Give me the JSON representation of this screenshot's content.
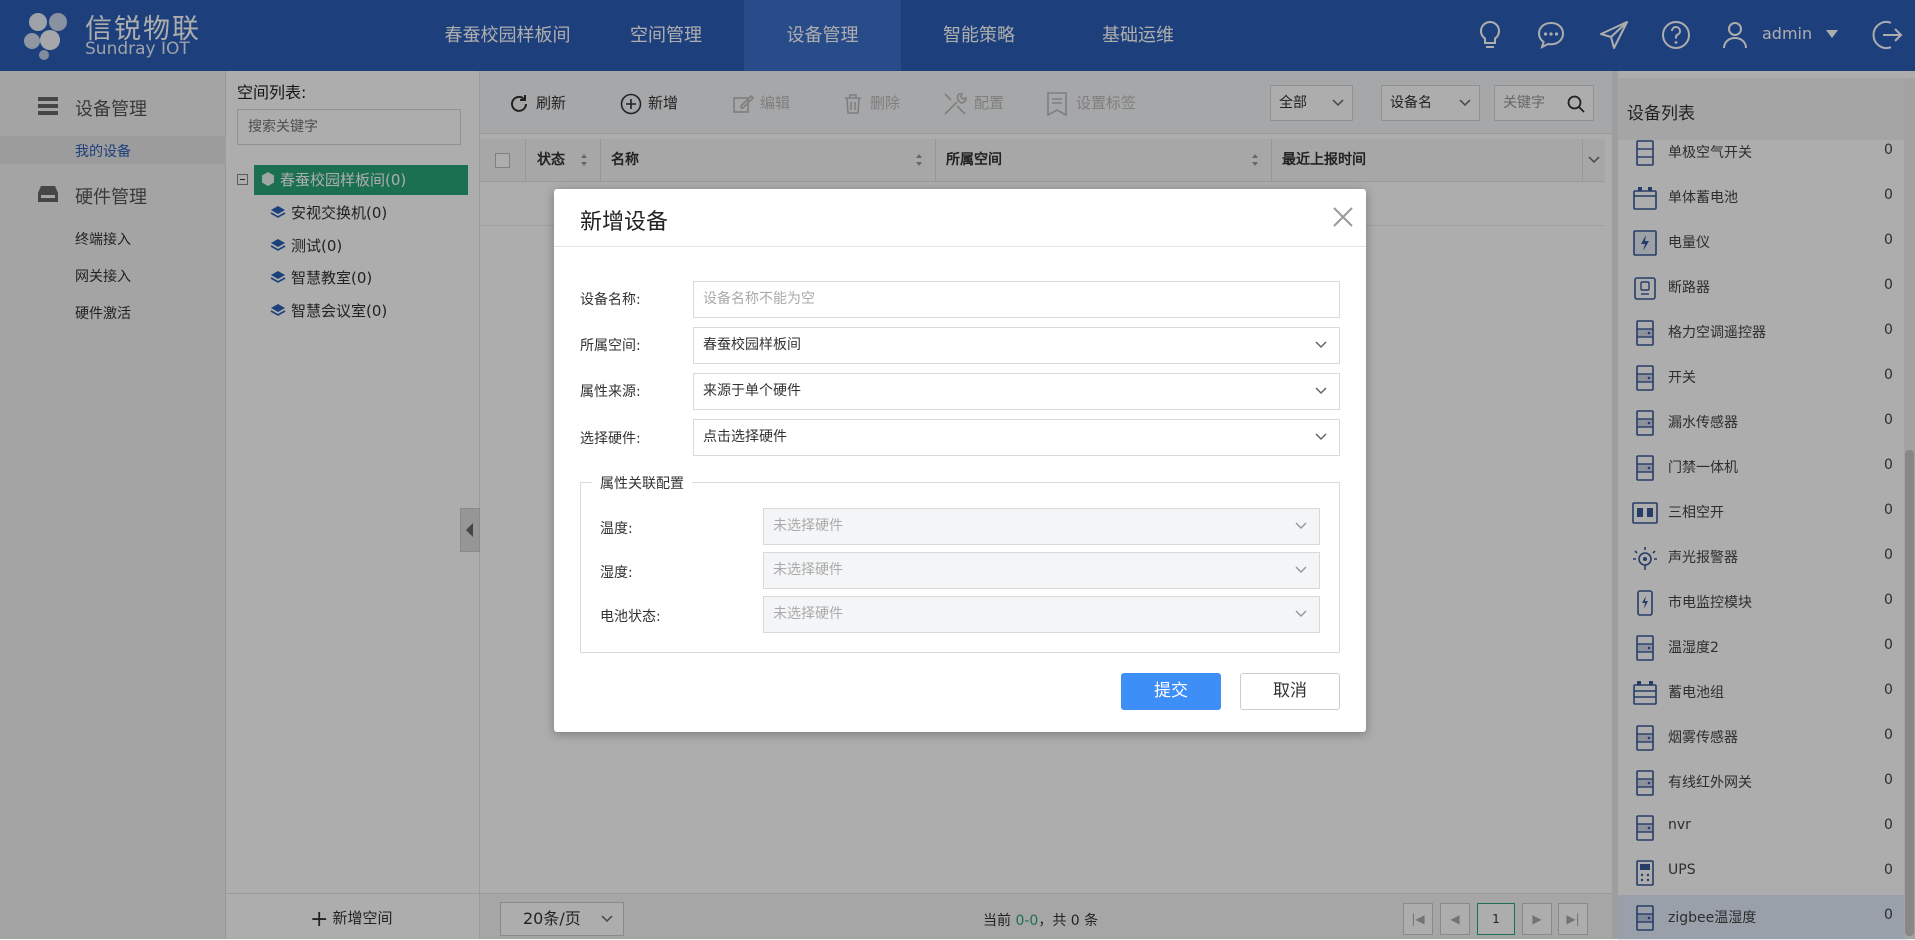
{
  "brand": {
    "name_cn": "信锐物联",
    "name_en": "Sundray IOT"
  },
  "nav": {
    "tabs": [
      {
        "label": "春蚕校园样板间"
      },
      {
        "label": "空间管理"
      },
      {
        "label": "设备管理"
      },
      {
        "label": "智能策略"
      },
      {
        "label": "基础运维"
      }
    ],
    "active_index": 2
  },
  "user": {
    "name": "admin"
  },
  "left_menu": {
    "group1": "设备管理",
    "group1_items": [
      "我的设备"
    ],
    "group2": "硬件管理",
    "group2_items": [
      "终端接入",
      "网关接入",
      "硬件激活"
    ]
  },
  "space_tree": {
    "title": "空间列表:",
    "search_placeholder": "搜索关键字",
    "root": "春蚕校园样板间(0)",
    "children": [
      "安视交换机(0)",
      "测试(0)",
      "智慧教室(0)",
      "智慧会议室(0)"
    ],
    "add_label": "新增空间"
  },
  "toolbar": {
    "refresh": "刷新",
    "add": "新增",
    "edit": "编辑",
    "delete": "删除",
    "config": "配置",
    "tag": "设置标签",
    "filter_all": "全部",
    "filter_field": "设备名",
    "keyword_placeholder": "关键字"
  },
  "table": {
    "columns": [
      "状态",
      "名称",
      "所属空间",
      "最近上报时间"
    ]
  },
  "footer": {
    "page_size": "20条/页",
    "info_prefix": "当前 ",
    "info_range": "0-0",
    "info_suffix": "，共 0 条",
    "current_page": "1"
  },
  "device_list": {
    "title": "设备列表",
    "items": [
      {
        "name": "单极空气开关",
        "count": "0",
        "icon": "breaker-icon"
      },
      {
        "name": "单体蓄电池",
        "count": "0",
        "icon": "battery-icon"
      },
      {
        "name": "电量仪",
        "count": "0",
        "icon": "power-meter-icon"
      },
      {
        "name": "断路器",
        "count": "0",
        "icon": "circuit-breaker-icon"
      },
      {
        "name": "格力空调遥控器",
        "count": "0",
        "icon": "server-icon"
      },
      {
        "name": "开关",
        "count": "0",
        "icon": "server-icon"
      },
      {
        "name": "漏水传感器",
        "count": "0",
        "icon": "server-icon"
      },
      {
        "name": "门禁一体机",
        "count": "0",
        "icon": "server-icon"
      },
      {
        "name": "三相空开",
        "count": "0",
        "icon": "three-phase-switch-icon"
      },
      {
        "name": "声光报警器",
        "count": "0",
        "icon": "alarm-icon"
      },
      {
        "name": "市电监控模块",
        "count": "0",
        "icon": "mains-monitor-icon"
      },
      {
        "name": "温湿度2",
        "count": "0",
        "icon": "server-icon"
      },
      {
        "name": "蓄电池组",
        "count": "0",
        "icon": "battery-group-icon"
      },
      {
        "name": "烟雾传感器",
        "count": "0",
        "icon": "server-icon"
      },
      {
        "name": "有线红外网关",
        "count": "0",
        "icon": "server-icon"
      },
      {
        "name": "nvr",
        "count": "0",
        "icon": "server-icon"
      },
      {
        "name": "UPS",
        "count": "0",
        "icon": "ups-icon"
      },
      {
        "name": "zigbee温湿度",
        "count": "0",
        "icon": "server-icon"
      }
    ]
  },
  "modal": {
    "title": "新增设备",
    "fields": {
      "name_label": "设备名称:",
      "name_placeholder": "设备名称不能为空",
      "space_label": "所属空间:",
      "space_value": "春蚕校园样板间",
      "source_label": "属性来源:",
      "source_value": "来源于单个硬件",
      "hardware_label": "选择硬件:",
      "hardware_value": "点击选择硬件"
    },
    "attr_section": {
      "legend": "属性关联配置",
      "rows": [
        {
          "label": "温度:",
          "value": "未选择硬件"
        },
        {
          "label": "湿度:",
          "value": "未选择硬件"
        },
        {
          "label": "电池状态:",
          "value": "未选择硬件"
        }
      ]
    },
    "submit": "提交",
    "cancel": "取消"
  },
  "colors": {
    "topbar": "#2c5fb7",
    "tree_active": "#2aa67a",
    "primary_button": "#3e8ef7"
  }
}
